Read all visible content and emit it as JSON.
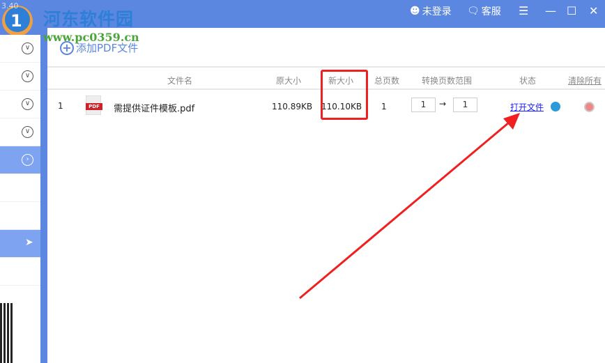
{
  "titlebar": {
    "version": "3.40",
    "login": "未登录",
    "service": "客服"
  },
  "watermark": {
    "name": "河东软件园",
    "url": "www.pc0359.cn"
  },
  "main": {
    "add_button": "添加PDF文件",
    "columns": {
      "filename": "文件名",
      "orig_size": "原大小",
      "new_size": "新大小",
      "pages": "总页数",
      "range": "转换页数范围",
      "status": "状态",
      "clear_all": "清除所有"
    },
    "rows": [
      {
        "index": "1",
        "icon_label": "PDF",
        "filename": "需提供证件模板.pdf",
        "orig_size": "110.89KB",
        "new_size": "110.10KB",
        "pages": "1",
        "range_from": "1",
        "range_to": "1",
        "status_link": "打开文件"
      }
    ]
  },
  "colors": {
    "accent": "#5b87e0",
    "highlight": "#f02020"
  }
}
